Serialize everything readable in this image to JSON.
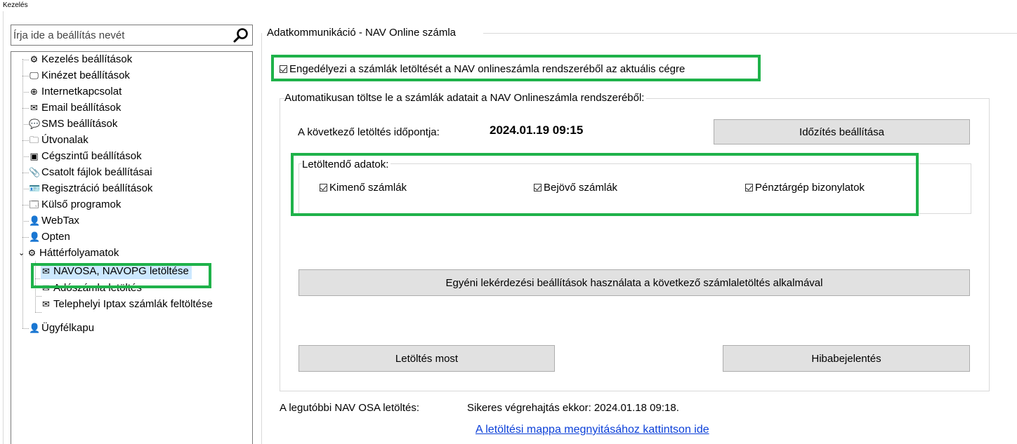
{
  "window": {
    "title": "Kezelés"
  },
  "search": {
    "placeholder": "Írja ide a beállítás nevét",
    "value": "",
    "icon": "search-icon"
  },
  "tree": {
    "items": [
      {
        "label": "Kezelés beállítások",
        "icon": "gear-icon",
        "glyph": "⚙"
      },
      {
        "label": "Kinézet beállítások",
        "icon": "monitor-icon",
        "glyph": "🖵"
      },
      {
        "label": "Internetkapcsolat",
        "icon": "globe-icon",
        "glyph": "⊕"
      },
      {
        "label": "Email beállítások",
        "icon": "envelope-icon",
        "glyph": "✉"
      },
      {
        "label": "SMS beállítások",
        "icon": "chat-icon",
        "glyph": "💬"
      },
      {
        "label": "Útvonalak",
        "icon": "folder-icon",
        "glyph": "🗀"
      },
      {
        "label": "Cégszintű beállítások",
        "icon": "building-icon",
        "glyph": "▣"
      },
      {
        "label": "Csatolt fájlok beállításai",
        "icon": "paperclip-icon",
        "glyph": "📎"
      },
      {
        "label": "Regisztráció beállítások",
        "icon": "id-card-icon",
        "glyph": "🪪"
      },
      {
        "label": "Külső programok",
        "icon": "window-icon",
        "glyph": "🗔"
      },
      {
        "label": "WebTax",
        "icon": "user-icon",
        "glyph": "👤"
      },
      {
        "label": "Opten",
        "icon": "user-icon",
        "glyph": "👤"
      },
      {
        "label": "Háttérfolyamatok",
        "icon": "gear-icon",
        "glyph": "⚙",
        "expanded": true,
        "children": [
          {
            "label": "NAVOSA, NAVOPG letöltése",
            "icon": "envelope-icon",
            "glyph": "✉",
            "selected": true
          },
          {
            "label": "Adószámla letöltés",
            "icon": "envelope-icon",
            "glyph": "✉"
          },
          {
            "label": "Telephelyi Iptax számlák feltöltése",
            "icon": "envelope-icon",
            "glyph": "✉"
          }
        ]
      },
      {
        "label": "Ügyfélkapu",
        "icon": "user-icon",
        "glyph": "👤"
      }
    ]
  },
  "main": {
    "group_title": "Adatkommunikáció - NAV Online számla",
    "enable_checkbox": {
      "label": "Engedélyezi a számlák letöltését a NAV onlineszámla rendszeréből az aktuális cégre",
      "checked": true
    },
    "auto_group_title": "Automatikusan töltse le a számlák adatait a NAV Onlineszámla rendszeréből:",
    "next_download_label": "A következő letöltés időpontja:",
    "next_download_value": "2024.01.19 09:15",
    "schedule_button": "Időzítés beállítása",
    "data_group_title": "Letöltendő adatok:",
    "data_checkboxes": [
      {
        "label": "Kimenő számlák",
        "checked": true
      },
      {
        "label": "Bejövő számlák",
        "checked": true
      },
      {
        "label": "Pénztárgép bizonylatok",
        "checked": true
      }
    ],
    "custom_query_button": "Egyéni lekérdezési beállítások használata a következő számlaletöltés alkalmával",
    "download_now_button": "Letöltés most",
    "error_report_button": "Hibabejelentés",
    "last_download_label": "A legutóbbi NAV OSA letöltés:",
    "last_download_status": "Sikeres végrehajtás ekkor: 2024.01.18 09:18.",
    "open_folder_link": "A letöltési mappa megnyitásához kattintson ide"
  },
  "colors": {
    "highlight": "#1fb24a",
    "selection": "#cce8ff",
    "link": "#0a3fd8",
    "button": "#e1e1e1"
  }
}
